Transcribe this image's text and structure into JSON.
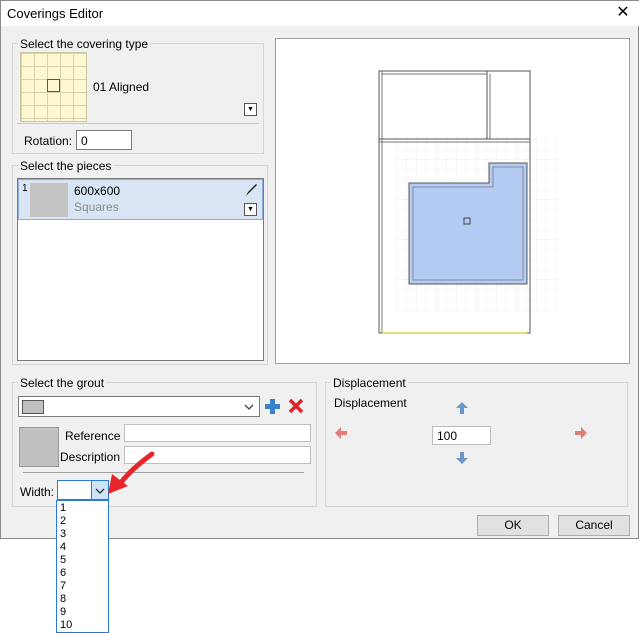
{
  "window": {
    "title": "Coverings Editor",
    "close_glyph": "✕"
  },
  "covering": {
    "group_label": "Select the covering type",
    "name": "01 Aligned",
    "rotation_label": "Rotation:",
    "rotation_value": "0"
  },
  "pieces": {
    "group_label": "Select the pieces",
    "items": [
      {
        "index": "1",
        "name": "600x600",
        "type": "Squares"
      }
    ]
  },
  "grout": {
    "group_label": "Select the grout",
    "reference_label": "Reference",
    "description_label": "Description",
    "reference_value": "",
    "description_value": "",
    "width_label": "Width:",
    "width_value": "",
    "width_options": [
      "1",
      "2",
      "3",
      "4",
      "5",
      "6",
      "7",
      "8",
      "9",
      "10"
    ]
  },
  "displacement": {
    "group_label": "Displacement",
    "inner_label": "Displacement",
    "value": "100"
  },
  "buttons": {
    "ok": "OK",
    "cancel": "Cancel"
  },
  "colors": {
    "accent_red": "#e8262a",
    "arrow_blue": "#6a96c8",
    "arrow_red": "#e47b7b",
    "tile_fill": "#b4ccf4"
  },
  "icons": [
    "brush-icon",
    "add-icon",
    "delete-icon",
    "arrow-up-icon",
    "arrow-down-icon",
    "arrow-left-icon",
    "arrow-right-icon",
    "chevron-down-icon",
    "close-icon",
    "annotation-arrow"
  ]
}
